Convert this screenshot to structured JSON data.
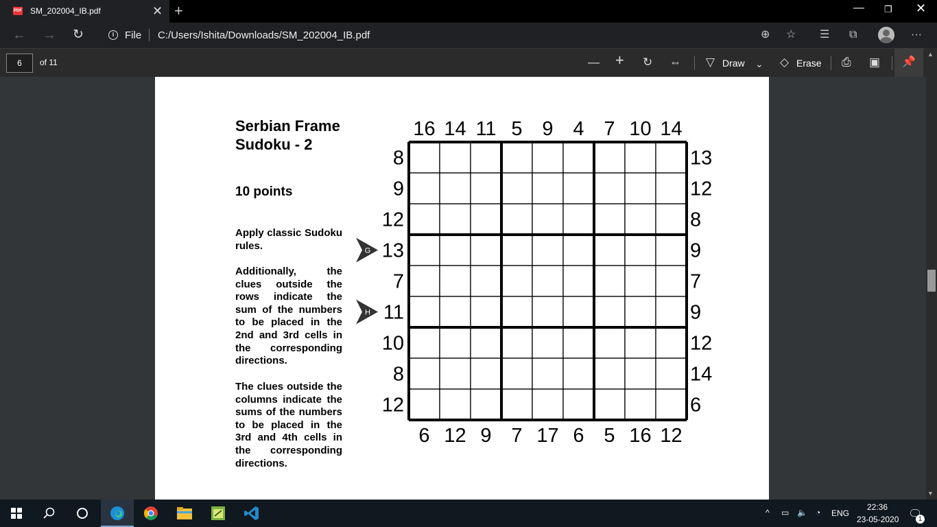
{
  "browser": {
    "tab_title": "SM_202004_IB.pdf",
    "tab_icon_label": "PDF",
    "file_label": "File",
    "url": "C:/Users/Ishita/Downloads/SM_202004_IB.pdf"
  },
  "pdf_toolbar": {
    "page_number": "6",
    "page_count": "of 11",
    "draw_label": "Draw",
    "erase_label": "Erase"
  },
  "puzzle": {
    "title": "Serbian Frame Sudoku - 2",
    "points": "10 points",
    "rule1": "Apply classic Sudoku rules.",
    "rule2_html": "Additionally, the clues outside the rows indicate the sum of the numbers to be placed in the 2nd and 3rd cells in the corresponding directions.",
    "rule3": "The clues outside the columns indicate the sums of the numbers to be placed in the 3rd and 4th cells in the corresponding directions.",
    "top_clues": [
      "16",
      "14",
      "11",
      "5",
      "9",
      "4",
      "7",
      "10",
      "14"
    ],
    "bottom_clues": [
      "6",
      "12",
      "9",
      "7",
      "17",
      "6",
      "5",
      "16",
      "12"
    ],
    "left_clues": [
      "8",
      "9",
      "12",
      "13",
      "7",
      "11",
      "10",
      "8",
      "12"
    ],
    "right_clues": [
      "13",
      "12",
      "8",
      "9",
      "7",
      "9",
      "12",
      "14",
      "6"
    ],
    "markers": [
      {
        "label": "G",
        "row": 3
      },
      {
        "label": "H",
        "row": 5
      }
    ]
  },
  "taskbar": {
    "language": "ENG",
    "time": "22:36",
    "date": "23-05-2020",
    "notification_count": "1"
  }
}
